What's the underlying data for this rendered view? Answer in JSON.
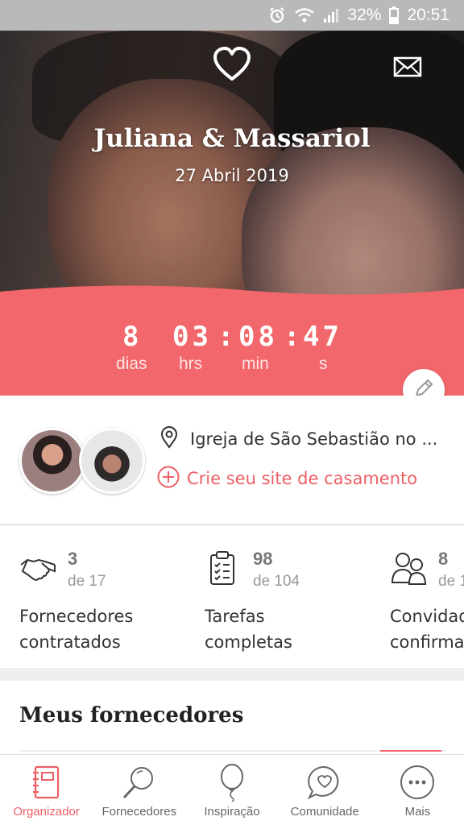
{
  "status_bar": {
    "battery": "32%",
    "time": "20:51"
  },
  "hero": {
    "couple_name": "Juliana & Massariol",
    "date": "27 Abril 2019"
  },
  "countdown": {
    "days": "8",
    "days_label": "dias",
    "hours": "03",
    "hours_label": "hrs",
    "minutes": "08",
    "minutes_label": "min",
    "seconds": "47",
    "seconds_label": "s",
    "separator": ":"
  },
  "profile": {
    "venue": "Igreja de São Sebastião no ...",
    "create_site": "Crie seu site de casamento"
  },
  "stats": [
    {
      "count": "3",
      "total": "de 17",
      "label_line1": "Fornecedores",
      "label_line2": "contratados",
      "icon": "handshake-icon"
    },
    {
      "count": "98",
      "total": "de 104",
      "label_line1": "Tarefas",
      "label_line2": "completas",
      "icon": "clipboard-icon"
    },
    {
      "count": "8",
      "total": "de 1",
      "label_line1": "Convidad",
      "label_line2": "confirma",
      "icon": "guests-icon"
    }
  ],
  "section": {
    "title": "Meus fornecedores"
  },
  "nav": [
    {
      "label": "Organizador",
      "icon": "notebook-icon",
      "active": true
    },
    {
      "label": "Fornecedores",
      "icon": "magnifier-icon",
      "active": false
    },
    {
      "label": "Inspiração",
      "icon": "balloon-icon",
      "active": false
    },
    {
      "label": "Comunidade",
      "icon": "chat-heart-icon",
      "active": false
    },
    {
      "label": "Mais",
      "icon": "more-icon",
      "active": false
    }
  ],
  "colors": {
    "accent": "#f2676b",
    "accent_text": "#ec5f64"
  }
}
